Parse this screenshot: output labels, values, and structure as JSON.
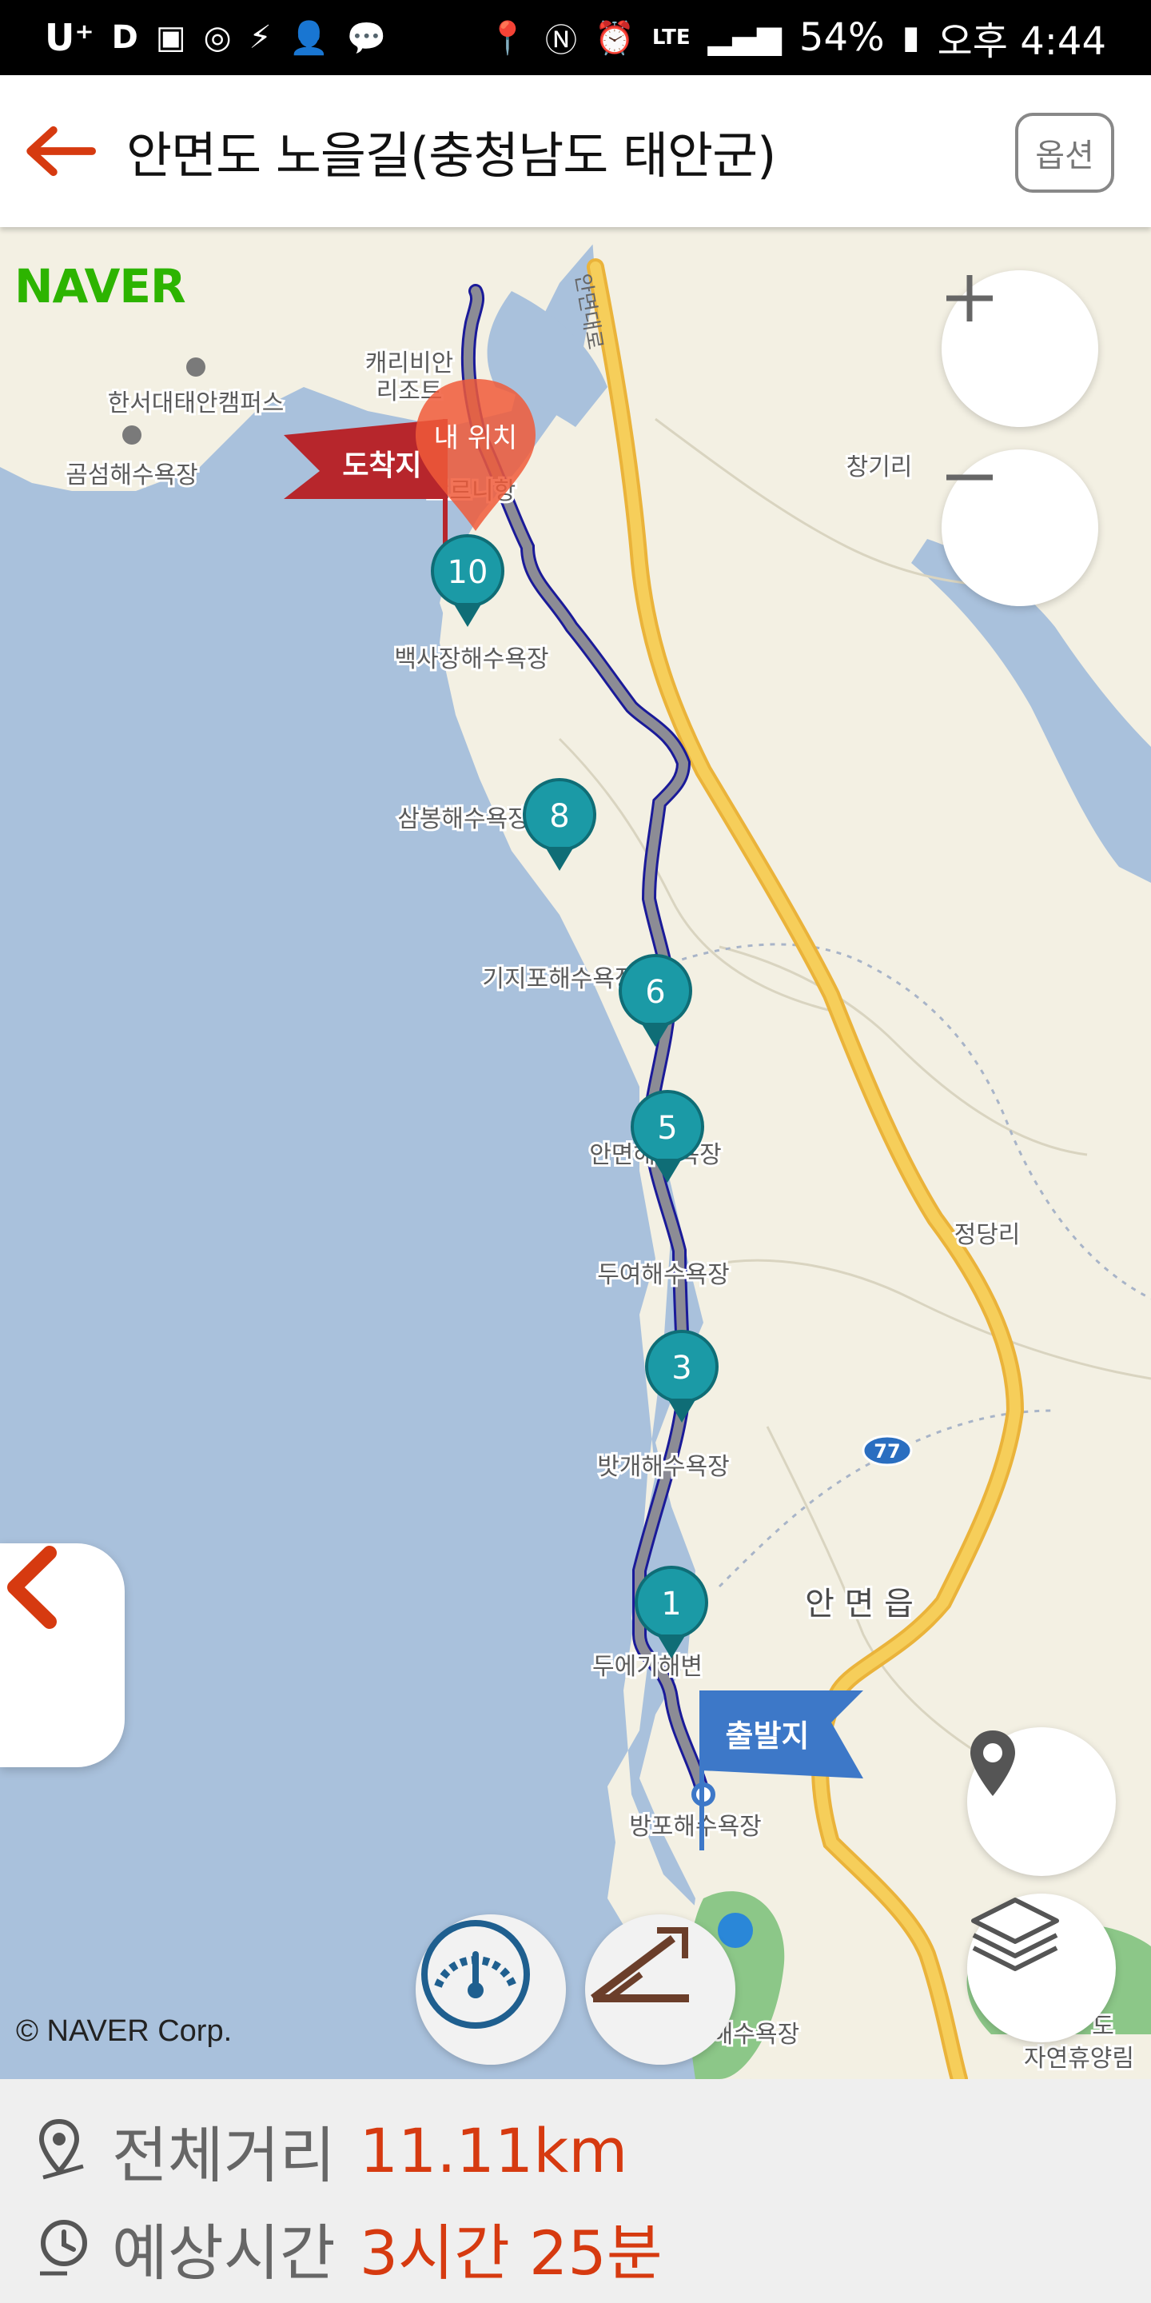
{
  "status_bar": {
    "carrier": "U⁺",
    "left_icons": [
      "D",
      "image-icon",
      "activity-icon",
      "v3-icon",
      "add-user-icon",
      "talk-icon"
    ],
    "battery_percent": "54%",
    "time": "오후 4:44"
  },
  "header": {
    "title": "안면도 노을길(충청남도 태안군)",
    "option_label": "옵션"
  },
  "map": {
    "provider": "NAVER",
    "copyright": "© NAVER Corp.",
    "start_flag": "출발지",
    "end_flag": "도착지",
    "my_location": "내 위치",
    "road_number": "77",
    "road_label": "안면대로",
    "route_markers": [
      "1",
      "3",
      "5",
      "6",
      "8",
      "10"
    ],
    "place_labels": {
      "campus": "한서대태안캠퍼스",
      "gomseom": "곰섬해수욕장",
      "caribbean": "캐리비안\n리조트",
      "dream_harbor": "드르니항",
      "baeksajang": "백사장해수욕장",
      "sambong": "삼봉해수욕장",
      "gijipo": "기지포해수욕장",
      "anmyeon_beach": "안면해수욕장",
      "duyeo": "두여해수욕장",
      "batgae": "밧개해수욕장",
      "duegi": "두에기해변",
      "bangpo": "방포해수욕장",
      "changgi": "창기리",
      "jeongdang": "정당리",
      "anmyeon_eup": "안 면 읍",
      "forest": "자연휴양림",
      "bottom_beach": "해수욕장",
      "bottom_do": "도"
    }
  },
  "summary": {
    "distance_label": "전체거리",
    "distance_value": "11.11km",
    "time_label": "예상시간",
    "time_value": "3시간 25분"
  },
  "colors": {
    "sea": "#a9c1dc",
    "land": "#f3f0e3",
    "highway": "#f6ce5a",
    "marker": "#1b9aa6",
    "start_flag": "#3d78c8",
    "end_flag": "#b7262c",
    "accent": "#d63a10",
    "naver_green": "#2db400"
  }
}
